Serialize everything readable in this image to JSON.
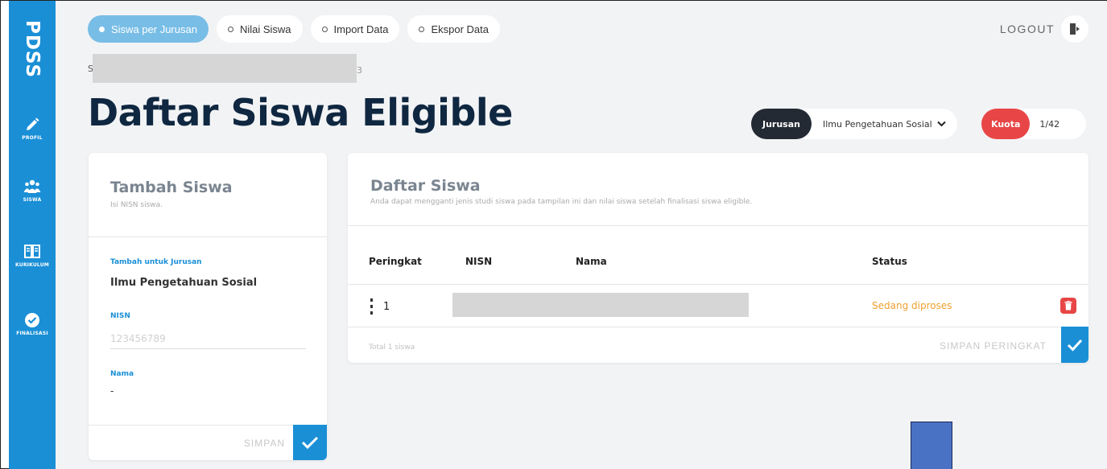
{
  "sidebar": {
    "brand": "PDSS",
    "items": [
      {
        "label": "PROFIL",
        "icon": "pencil-icon"
      },
      {
        "label": "SISWA",
        "icon": "users-icon"
      },
      {
        "label": "KURIKULUM",
        "icon": "book-icon"
      },
      {
        "label": "FINALISASI",
        "icon": "check-circle-icon"
      }
    ]
  },
  "tabs": [
    {
      "label": "Siswa per Jurusan",
      "active": true
    },
    {
      "label": "Nilai Siswa",
      "active": false
    },
    {
      "label": "Import Data",
      "active": false
    },
    {
      "label": "Ekspor Data",
      "active": false
    }
  ],
  "header": {
    "logout_label": "LOGOUT",
    "breadcrumb_prefix": "S",
    "breadcrumb_tail": "3",
    "page_title": "Daftar Siswa Eligible",
    "jurusan_label": "Jurusan",
    "jurusan_value": "Ilmu Pengetahuan Sosial",
    "kuota_label": "Kuota",
    "kuota_value": "1/42"
  },
  "add_form": {
    "title": "Tambah Siswa",
    "subtitle": "Isi NISN siswa.",
    "jurusan_label": "Tambah untuk Jurusan",
    "jurusan_value": "Ilmu Pengetahuan Sosial",
    "nisn_label": "NISN",
    "nisn_placeholder": "123456789",
    "nama_label": "Nama",
    "nama_value": "-",
    "save_label": "SIMPAN"
  },
  "student_list": {
    "title": "Daftar Siswa",
    "subtitle": "Anda dapat mengganti jenis studi siswa pada tampilan ini dan nilai siswa setelah finalisasi siswa eligible.",
    "columns": [
      "Peringkat",
      "NISN",
      "Nama",
      "Status"
    ],
    "rows": [
      {
        "rank": "1",
        "status": "Sedang diproses"
      }
    ],
    "total": "Total 1 siswa",
    "save_rank_label": "SIMPAN PERINGKAT"
  },
  "colors": {
    "sidebar": "#1a8fd6",
    "title": "#0f2740",
    "kuota": "#e84646",
    "status_processing": "#f0a030",
    "overlay_block": "#4a72c4"
  }
}
